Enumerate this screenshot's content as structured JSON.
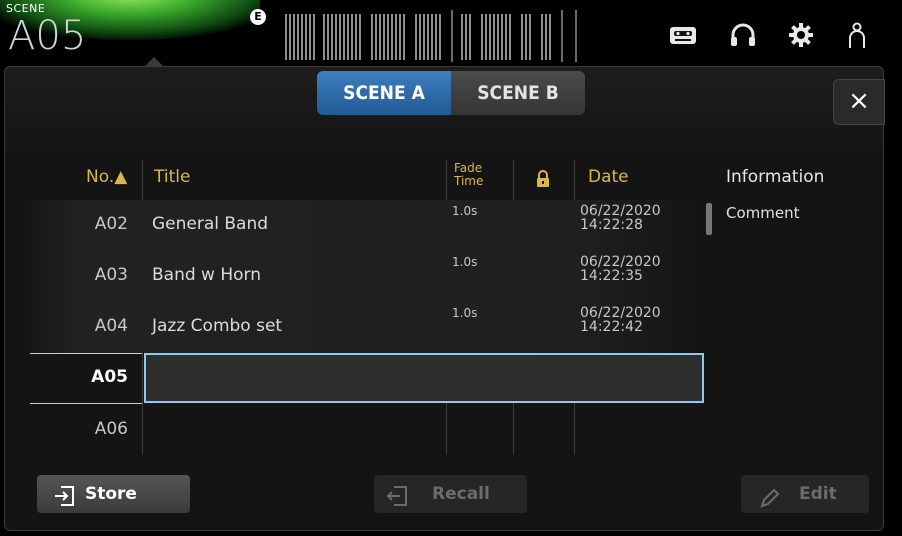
{
  "header": {
    "scene_label": "SCENE",
    "scene_number": "A05",
    "badge": "E"
  },
  "icons": {
    "recorder": "recorder-icon",
    "headphones": "headphones-icon",
    "settings": "gear-icon",
    "user": "user-icon"
  },
  "tabs": [
    {
      "label": "SCENE A",
      "active": true
    },
    {
      "label": "SCENE B",
      "active": false
    }
  ],
  "close_label": "×",
  "table": {
    "headers": {
      "no": "No.▲",
      "title": "Title",
      "fade_time_line1": "Fade",
      "fade_time_line2": "Time",
      "date": "Date",
      "information": "Information"
    },
    "rows": [
      {
        "no": "A02",
        "title": "General Band",
        "fade": "1.0s",
        "date1": "06/22/2020",
        "date2": "14:22:28"
      },
      {
        "no": "A03",
        "title": "Band w Horn",
        "fade": "1.0s",
        "date1": "06/22/2020",
        "date2": "14:22:35"
      },
      {
        "no": "A04",
        "title": "Jazz Combo set",
        "fade": "1.0s",
        "date1": "06/22/2020",
        "date2": "14:22:42"
      },
      {
        "no": "A05",
        "title": "",
        "fade": "",
        "date1": "",
        "date2": ""
      },
      {
        "no": "A06",
        "title": "",
        "fade": "",
        "date1": "",
        "date2": ""
      }
    ],
    "selected_row": "A05"
  },
  "information": {
    "comment_label": "Comment"
  },
  "buttons": {
    "store": "Store",
    "recall": "Recall",
    "edit": "Edit"
  },
  "colors": {
    "accent_blue": "#2f6fae",
    "header_gold": "#d8b84a",
    "selection_outline": "#8ec9f2"
  }
}
